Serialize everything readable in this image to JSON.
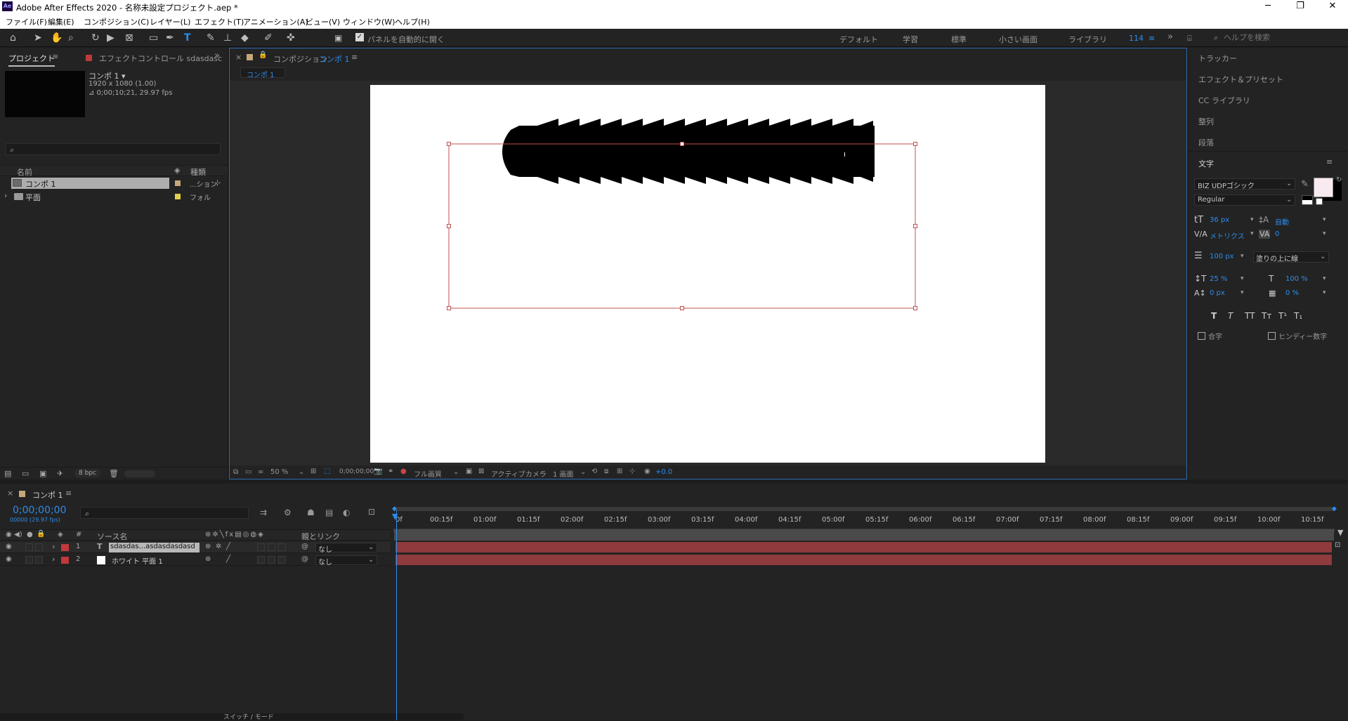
{
  "window": {
    "title": "Adobe After Effects 2020 - 名称未設定プロジェクト.aep *",
    "app_icon": "Ae"
  },
  "menu": [
    "ファイル(F)",
    "編集(E)",
    "コンポジション(C)",
    "レイヤー(L)",
    "エフェクト(T)",
    "アニメーション(A)",
    "ビュー(V)",
    "ウィンドウ(W)",
    "ヘルプ(H)"
  ],
  "toolbar": {
    "auto_open_label": "パネルを自動的に開く",
    "workspaces": [
      "デフォルト",
      "学習",
      "標準",
      "小さい画面",
      "ライブラリ"
    ],
    "workspace_count": "114",
    "help_search_placeholder": "ヘルプを検索"
  },
  "project": {
    "tab_label": "プロジェクト",
    "effect_tab_label": "エフェクトコントロール sdasdasc",
    "item_name": "コンポ 1 ▾",
    "item_info1": "1920 x 1080 (1.00)",
    "item_info2": "⊿ 0;00;10;21, 29.97 fps",
    "col_name": "名前",
    "col_type": "種類",
    "rows": [
      {
        "name": "コンポ 1",
        "type": "...ション",
        "color": "#c6a77a"
      },
      {
        "name": "平面",
        "type": "フォル",
        "color": "#e2cf4b"
      }
    ],
    "bpc": "8 bpc"
  },
  "composition": {
    "tab_prefix": "コンポジション",
    "tab_name": "コンポ 1",
    "breadcrumb": "コンポ 1",
    "zoom": "50 %",
    "timecode": "0;00;00;00",
    "quality": "フル画質",
    "camera": "アクティブカメラ",
    "views": "1 画面",
    "exposure": "+0.0"
  },
  "right_panels": {
    "items": [
      "トラッカー",
      "エフェクト＆プリセット",
      "CC ライブラリ",
      "整列",
      "段落"
    ],
    "character_title": "文字",
    "font_family": "BIZ UDPゴシック",
    "font_style": "Regular",
    "font_size": "36 px",
    "leading": "自動",
    "kerning": "メトリクス",
    "tracking": "0",
    "stroke_width": "100 px",
    "stroke_mode": "塗りの上に線",
    "vert_scale": "25 %",
    "horiz_scale": "100 %",
    "baseline": "0 px",
    "tsume": "0 %",
    "style_buttons": [
      "T",
      "T",
      "TT",
      "Tт",
      "T¹",
      "T₁"
    ],
    "ligature_label": "合字",
    "hindi_label": "ヒンディー数字",
    "fill_color": "#f8eaf0",
    "stroke_color": "#000000"
  },
  "timeline": {
    "tab_name": "コンポ 1",
    "timecode": "0;00;00;00",
    "timecode_sub": "00000 (29.97 fps)",
    "col_source": "ソース名",
    "col_parent": "親とリンク",
    "col_num": "#",
    "ruler": [
      "0f",
      "00:15f",
      "01:00f",
      "01:15f",
      "02:00f",
      "02:15f",
      "03:00f",
      "03:15f",
      "04:00f",
      "04:15f",
      "05:00f",
      "05:15f",
      "06:00f",
      "06:15f",
      "07:00f",
      "07:15f",
      "08:00f",
      "08:15f",
      "09:00f",
      "09:15f",
      "10:00f",
      "10:15f"
    ],
    "layers": [
      {
        "num": "1",
        "name": "sdasdas...asdasdasdasd",
        "type_glyph": "T",
        "parent": "なし",
        "label_color": "#c0393b"
      },
      {
        "num": "2",
        "name": "ホワイト 平面 1",
        "type_glyph": "",
        "parent": "なし",
        "label_color": "#c0393b"
      }
    ],
    "bottom_label": "スイッチ / モード"
  }
}
